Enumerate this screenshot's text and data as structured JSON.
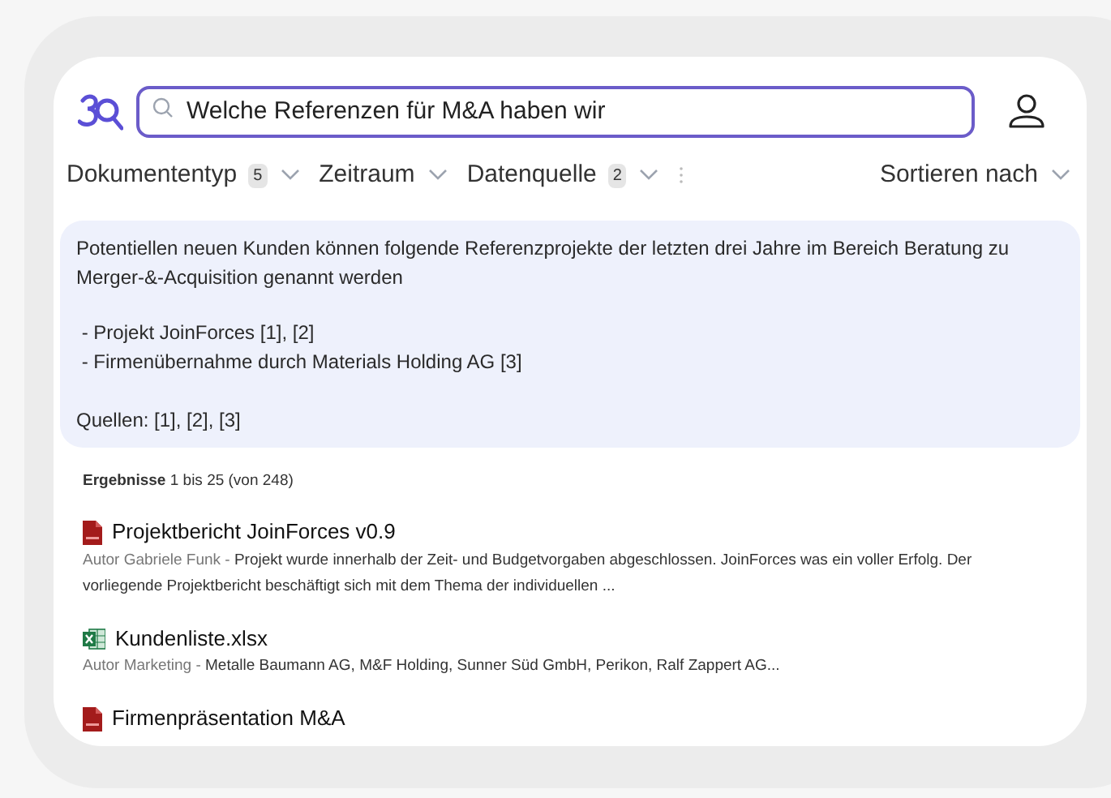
{
  "search": {
    "value": "Welche Referenzen für M&A haben wir"
  },
  "filters": [
    {
      "label": "Dokumententyp",
      "count": "5"
    },
    {
      "label": "Zeitraum"
    },
    {
      "label": "Datenquelle",
      "count": "2"
    }
  ],
  "sort": {
    "label": "Sortieren nach"
  },
  "answer": {
    "intro": "Potentiellen neuen Kunden können folgende Referenzprojekte der letzten drei Jahre im Bereich Beratung zu Merger-&-Acquisition genannt werden",
    "items": [
      "- Projekt JoinForces [1], [2]",
      "- Firmenübernahme durch Materials Holding AG [3]"
    ],
    "sources": "Quellen: [1], [2], [3]"
  },
  "results": {
    "label": "Ergebnisse",
    "range": "1 bis 25 (von 248)",
    "items": [
      {
        "kind": "pdf",
        "title": "Projektbericht JoinForces v0.9",
        "author": "Autor Gabriele Funk -",
        "snippet": "Projekt wurde innerhalb der Zeit- und Budgetvorgaben abgeschlossen. JoinForces was ein voller Erfolg. Der vorliegende Projektbericht beschäftigt sich mit dem Thema der individuellen ..."
      },
      {
        "kind": "xlsx",
        "title": "Kundenliste.xlsx",
        "author": "Autor Marketing -",
        "snippet": "Metalle Baumann AG, M&F Holding, Sunner Süd GmbH, Perikon, Ralf Zappert AG..."
      },
      {
        "kind": "pdf",
        "title": "Firmenpräsentation M&A"
      }
    ]
  }
}
